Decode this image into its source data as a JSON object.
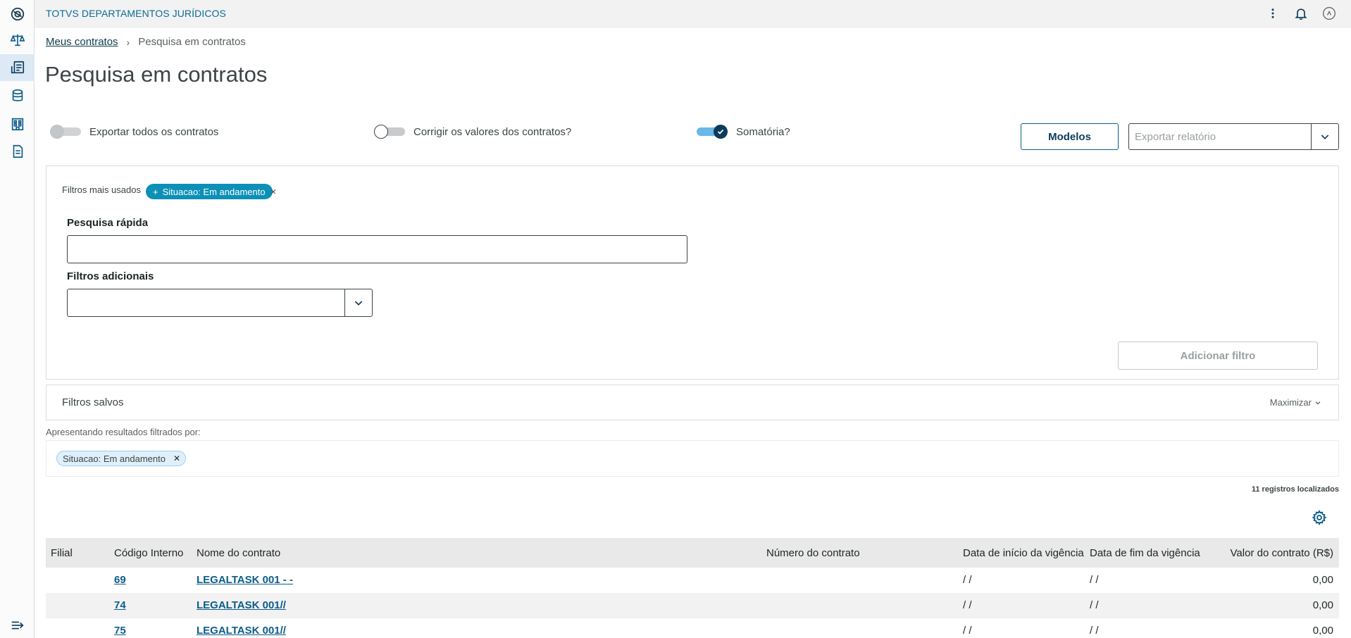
{
  "header": {
    "app_title": "TOTVS DEPARTAMENTOS JURÍDICOS"
  },
  "sidebar": {
    "items": [
      {
        "name": "totvs-logo-icon"
      },
      {
        "name": "scales-icon"
      },
      {
        "name": "contracts-icon",
        "active": true
      },
      {
        "name": "database-icon"
      },
      {
        "name": "building-icon"
      },
      {
        "name": "document-icon"
      }
    ],
    "collapse_icon": "collapse-menu-icon"
  },
  "breadcrumb": {
    "parent": "Meus contratos",
    "current": "Pesquisa em contratos"
  },
  "page": {
    "title": "Pesquisa em contratos"
  },
  "toggles": {
    "export_all": {
      "label": "Exportar todos os contratos",
      "state": "off-disabled"
    },
    "correct_values": {
      "label": "Corrigir os valores dos contratos?",
      "state": "off"
    },
    "sum": {
      "label": "Somatória?",
      "state": "on"
    }
  },
  "actions": {
    "modelos_label": "Modelos",
    "export_placeholder": "Exportar relatório"
  },
  "filters": {
    "most_used_label": "Filtros mais usados",
    "most_used_chip": "Situacao: Em andamento",
    "quick_search_label": "Pesquisa rápida",
    "quick_search_value": "",
    "additional_label": "Filtros adicionais",
    "add_filter_label": "Adicionar filtro"
  },
  "saved_filters": {
    "title": "Filtros salvos",
    "maximize_label": "Maximizar"
  },
  "results": {
    "label": "Apresentando resultados filtrados por:",
    "active_chip": "Situacao: Em andamento",
    "count_label": "11 registros localizados"
  },
  "table": {
    "columns": {
      "filial": "Filial",
      "codigo": "Código Interno",
      "nome": "Nome do contrato",
      "numero": "Número do contrato",
      "inicio": "Data de início da vigência",
      "fim": "Data de fim da vigência",
      "valor": "Valor do contrato (R$)"
    },
    "rows": [
      {
        "filial": "",
        "codigo": "69",
        "nome": "LEGALTASK 001 - -",
        "numero": "",
        "inicio": "/ /",
        "fim": "/ /",
        "valor": "0,00"
      },
      {
        "filial": "",
        "codigo": "74",
        "nome": "LEGALTASK 001//",
        "numero": "",
        "inicio": "/ /",
        "fim": "/ /",
        "valor": "0,00"
      },
      {
        "filial": "",
        "codigo": "75",
        "nome": "LEGALTASK 001//",
        "numero": "",
        "inicio": "/ /",
        "fim": "/ /",
        "valor": "0,00"
      }
    ]
  },
  "colors": {
    "primary": "#0c5c8c",
    "accent_chip": "#0c90b8",
    "title_text": "#0c6c94"
  }
}
